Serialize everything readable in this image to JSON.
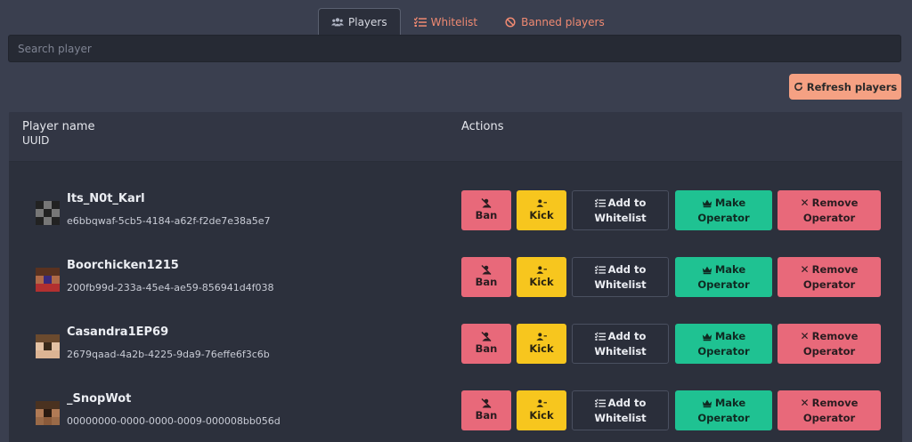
{
  "tabs": [
    {
      "label": "Players",
      "icon": "users-icon",
      "active": true
    },
    {
      "label": "Whitelist",
      "icon": "list-check-icon",
      "active": false
    },
    {
      "label": "Banned players",
      "icon": "ban-icon",
      "active": false
    }
  ],
  "search": {
    "placeholder": "Search player",
    "value": ""
  },
  "refresh_label": "Refresh players",
  "table": {
    "col_name": "Player name",
    "col_uuid": "UUID",
    "col_actions": "Actions"
  },
  "actions": {
    "ban": "Ban",
    "kick": "Kick",
    "whitelist_1": "Add to",
    "whitelist_2": "Whitelist",
    "op_1": "Make",
    "op_2": "Operator",
    "rem_1": "Remove",
    "rem_2": "Operator"
  },
  "players": [
    {
      "name": "Its_N0t_Karl",
      "uuid": "e6bbqwaf-5cb5-4184-a62f-f2de7e38a5e7"
    },
    {
      "name": "Boorchicken1215",
      "uuid": "200fb99d-233a-45e4-ae59-856941d4f038"
    },
    {
      "name": "Casandra1EP69",
      "uuid": "2679qaad-4a2b-4225-9da9-76effe6f3c6b"
    },
    {
      "name": "_SnopWot",
      "uuid": "00000000-0000-0000-0009-000008bb056d"
    }
  ],
  "colors": {
    "accent": "#f08a72",
    "ban": "#e8697a",
    "kick": "#f7c61e",
    "operator": "#1fc292"
  }
}
